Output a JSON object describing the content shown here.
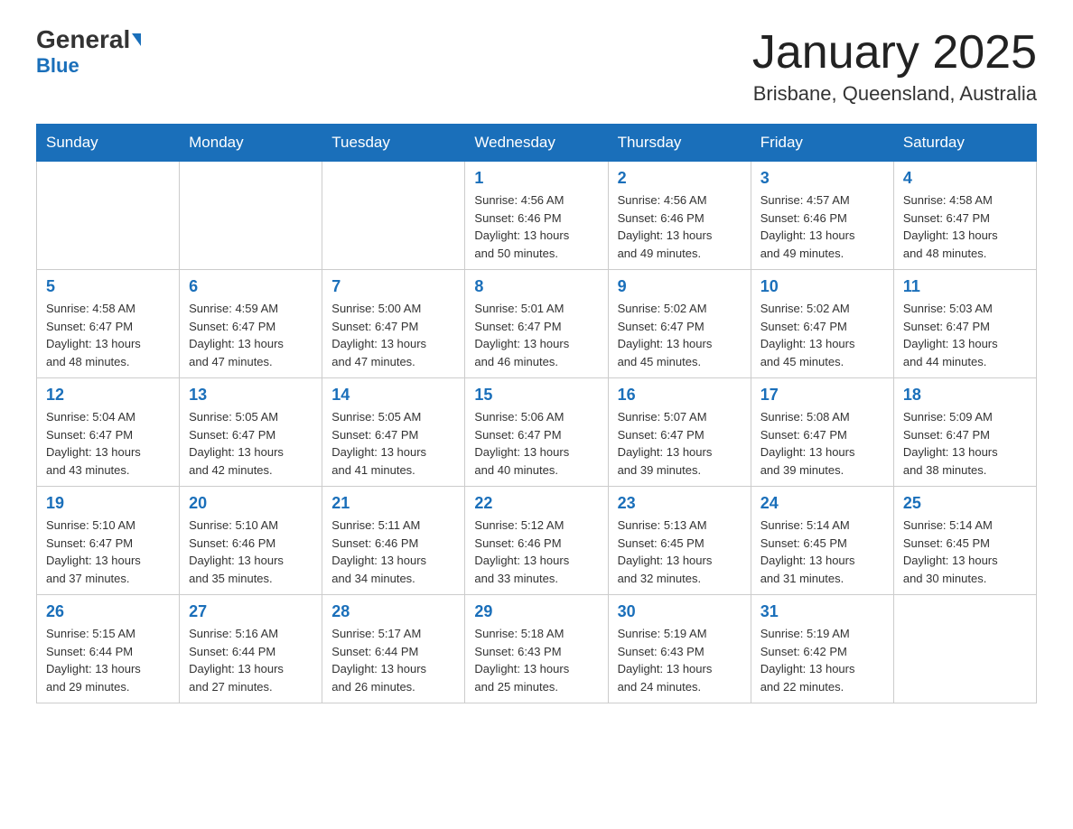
{
  "header": {
    "logo_main": "General",
    "logo_sub": "Blue",
    "month_title": "January 2025",
    "location": "Brisbane, Queensland, Australia"
  },
  "weekdays": [
    "Sunday",
    "Monday",
    "Tuesday",
    "Wednesday",
    "Thursday",
    "Friday",
    "Saturday"
  ],
  "weeks": [
    [
      {
        "day": "",
        "info": ""
      },
      {
        "day": "",
        "info": ""
      },
      {
        "day": "",
        "info": ""
      },
      {
        "day": "1",
        "info": "Sunrise: 4:56 AM\nSunset: 6:46 PM\nDaylight: 13 hours\nand 50 minutes."
      },
      {
        "day": "2",
        "info": "Sunrise: 4:56 AM\nSunset: 6:46 PM\nDaylight: 13 hours\nand 49 minutes."
      },
      {
        "day": "3",
        "info": "Sunrise: 4:57 AM\nSunset: 6:46 PM\nDaylight: 13 hours\nand 49 minutes."
      },
      {
        "day": "4",
        "info": "Sunrise: 4:58 AM\nSunset: 6:47 PM\nDaylight: 13 hours\nand 48 minutes."
      }
    ],
    [
      {
        "day": "5",
        "info": "Sunrise: 4:58 AM\nSunset: 6:47 PM\nDaylight: 13 hours\nand 48 minutes."
      },
      {
        "day": "6",
        "info": "Sunrise: 4:59 AM\nSunset: 6:47 PM\nDaylight: 13 hours\nand 47 minutes."
      },
      {
        "day": "7",
        "info": "Sunrise: 5:00 AM\nSunset: 6:47 PM\nDaylight: 13 hours\nand 47 minutes."
      },
      {
        "day": "8",
        "info": "Sunrise: 5:01 AM\nSunset: 6:47 PM\nDaylight: 13 hours\nand 46 minutes."
      },
      {
        "day": "9",
        "info": "Sunrise: 5:02 AM\nSunset: 6:47 PM\nDaylight: 13 hours\nand 45 minutes."
      },
      {
        "day": "10",
        "info": "Sunrise: 5:02 AM\nSunset: 6:47 PM\nDaylight: 13 hours\nand 45 minutes."
      },
      {
        "day": "11",
        "info": "Sunrise: 5:03 AM\nSunset: 6:47 PM\nDaylight: 13 hours\nand 44 minutes."
      }
    ],
    [
      {
        "day": "12",
        "info": "Sunrise: 5:04 AM\nSunset: 6:47 PM\nDaylight: 13 hours\nand 43 minutes."
      },
      {
        "day": "13",
        "info": "Sunrise: 5:05 AM\nSunset: 6:47 PM\nDaylight: 13 hours\nand 42 minutes."
      },
      {
        "day": "14",
        "info": "Sunrise: 5:05 AM\nSunset: 6:47 PM\nDaylight: 13 hours\nand 41 minutes."
      },
      {
        "day": "15",
        "info": "Sunrise: 5:06 AM\nSunset: 6:47 PM\nDaylight: 13 hours\nand 40 minutes."
      },
      {
        "day": "16",
        "info": "Sunrise: 5:07 AM\nSunset: 6:47 PM\nDaylight: 13 hours\nand 39 minutes."
      },
      {
        "day": "17",
        "info": "Sunrise: 5:08 AM\nSunset: 6:47 PM\nDaylight: 13 hours\nand 39 minutes."
      },
      {
        "day": "18",
        "info": "Sunrise: 5:09 AM\nSunset: 6:47 PM\nDaylight: 13 hours\nand 38 minutes."
      }
    ],
    [
      {
        "day": "19",
        "info": "Sunrise: 5:10 AM\nSunset: 6:47 PM\nDaylight: 13 hours\nand 37 minutes."
      },
      {
        "day": "20",
        "info": "Sunrise: 5:10 AM\nSunset: 6:46 PM\nDaylight: 13 hours\nand 35 minutes."
      },
      {
        "day": "21",
        "info": "Sunrise: 5:11 AM\nSunset: 6:46 PM\nDaylight: 13 hours\nand 34 minutes."
      },
      {
        "day": "22",
        "info": "Sunrise: 5:12 AM\nSunset: 6:46 PM\nDaylight: 13 hours\nand 33 minutes."
      },
      {
        "day": "23",
        "info": "Sunrise: 5:13 AM\nSunset: 6:45 PM\nDaylight: 13 hours\nand 32 minutes."
      },
      {
        "day": "24",
        "info": "Sunrise: 5:14 AM\nSunset: 6:45 PM\nDaylight: 13 hours\nand 31 minutes."
      },
      {
        "day": "25",
        "info": "Sunrise: 5:14 AM\nSunset: 6:45 PM\nDaylight: 13 hours\nand 30 minutes."
      }
    ],
    [
      {
        "day": "26",
        "info": "Sunrise: 5:15 AM\nSunset: 6:44 PM\nDaylight: 13 hours\nand 29 minutes."
      },
      {
        "day": "27",
        "info": "Sunrise: 5:16 AM\nSunset: 6:44 PM\nDaylight: 13 hours\nand 27 minutes."
      },
      {
        "day": "28",
        "info": "Sunrise: 5:17 AM\nSunset: 6:44 PM\nDaylight: 13 hours\nand 26 minutes."
      },
      {
        "day": "29",
        "info": "Sunrise: 5:18 AM\nSunset: 6:43 PM\nDaylight: 13 hours\nand 25 minutes."
      },
      {
        "day": "30",
        "info": "Sunrise: 5:19 AM\nSunset: 6:43 PM\nDaylight: 13 hours\nand 24 minutes."
      },
      {
        "day": "31",
        "info": "Sunrise: 5:19 AM\nSunset: 6:42 PM\nDaylight: 13 hours\nand 22 minutes."
      },
      {
        "day": "",
        "info": ""
      }
    ]
  ]
}
